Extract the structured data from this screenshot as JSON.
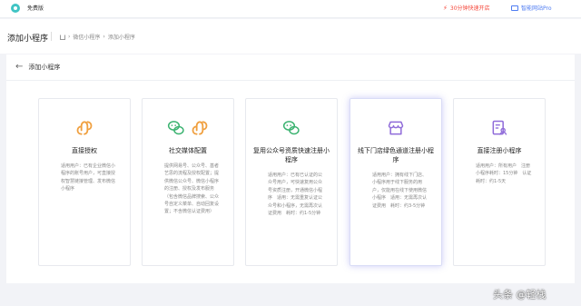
{
  "topbar": {
    "edition": "免费版",
    "promo": "30分钟快速开店",
    "upgrade": "智能网站Pro"
  },
  "header": {
    "title": "添加小程序",
    "breadcrumb": [
      "微信小程序",
      "添加小程序"
    ]
  },
  "main": {
    "back_label": "添加小程序",
    "cards": [
      {
        "title": "直接授权",
        "desc": "适用用户：已有企业微信小程序的账号用户，可直接授权智慧链接管理、发布微信小程序"
      },
      {
        "title": "社交媒体配置",
        "desc": "提供网易号、公众号、基者艺思的流程及授权配置；提供微信公众号、微信小程序的注册、授权及发布服务（包含微信品牌搜索、公众号自定义菜单、自动回复设置；不含微信认证费用）"
      },
      {
        "title": "复用公众号资质快速注册小程序",
        "desc": "适用用户：已有已认证的公众号用户，可快速复用公众号资质注册，开通微信小程序　适用：无需重复认证公众号和小程序，无需再次认证费用　耗时：约1-5分钟"
      },
      {
        "title": "线下门店绿色通道注册小程序",
        "desc": "适用用户：拥有线下门店、小程序用于线下服务的用户，仅能用在线下使用微信小程序　适用：无需再次认证费用　耗时：约3-5分钟"
      },
      {
        "title": "直接注册小程序",
        "desc": "适用用户：所有用户　注册小程序耗时：15分钟　认证耗时：约1-5天"
      }
    ]
  },
  "watermark": "头条 @轻栈",
  "colors": {
    "orange": "#f0a040",
    "green": "#3cb371",
    "purple": "#8f6bd9",
    "promo_red": "#f5483b",
    "link_blue": "#4e7cf2"
  }
}
